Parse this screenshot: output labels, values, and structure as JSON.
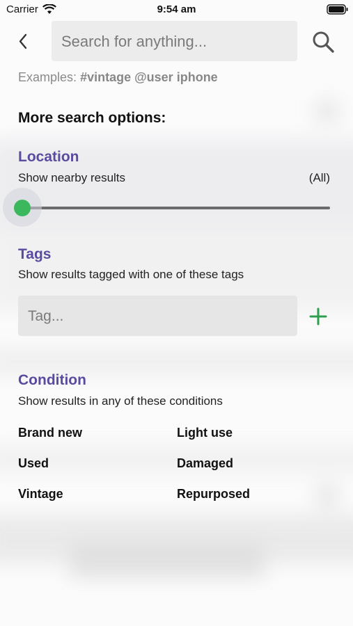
{
  "status_bar": {
    "carrier": "Carrier",
    "time": "9:54 am",
    "icons": [
      "wifi-icon",
      "battery-icon"
    ]
  },
  "header": {
    "back_icon": "chevron-left-icon",
    "search_placeholder": "Search for anything...",
    "search_icon": "search-icon"
  },
  "examples": {
    "label": "Examples:",
    "hashtag": "#vintage",
    "user": "@user",
    "keyword": "iphone"
  },
  "more_options_title": "More search options:",
  "location": {
    "title": "Location",
    "subtitle": "Show nearby results",
    "value": "(All)",
    "slider_fraction": 0
  },
  "tags": {
    "title": "Tags",
    "subtitle": "Show results tagged with one of these tags",
    "input_placeholder": "Tag...",
    "add_icon": "plus-icon"
  },
  "condition": {
    "title": "Condition",
    "subtitle": "Show results in any of these conditions",
    "options": [
      "Brand new",
      "Light use",
      "Used",
      "Damaged",
      "Vintage",
      "Repurposed"
    ]
  },
  "colors": {
    "accent_purple": "#5a4aa0",
    "slider_green": "#3bb85d",
    "add_green": "#2e9e4f"
  }
}
